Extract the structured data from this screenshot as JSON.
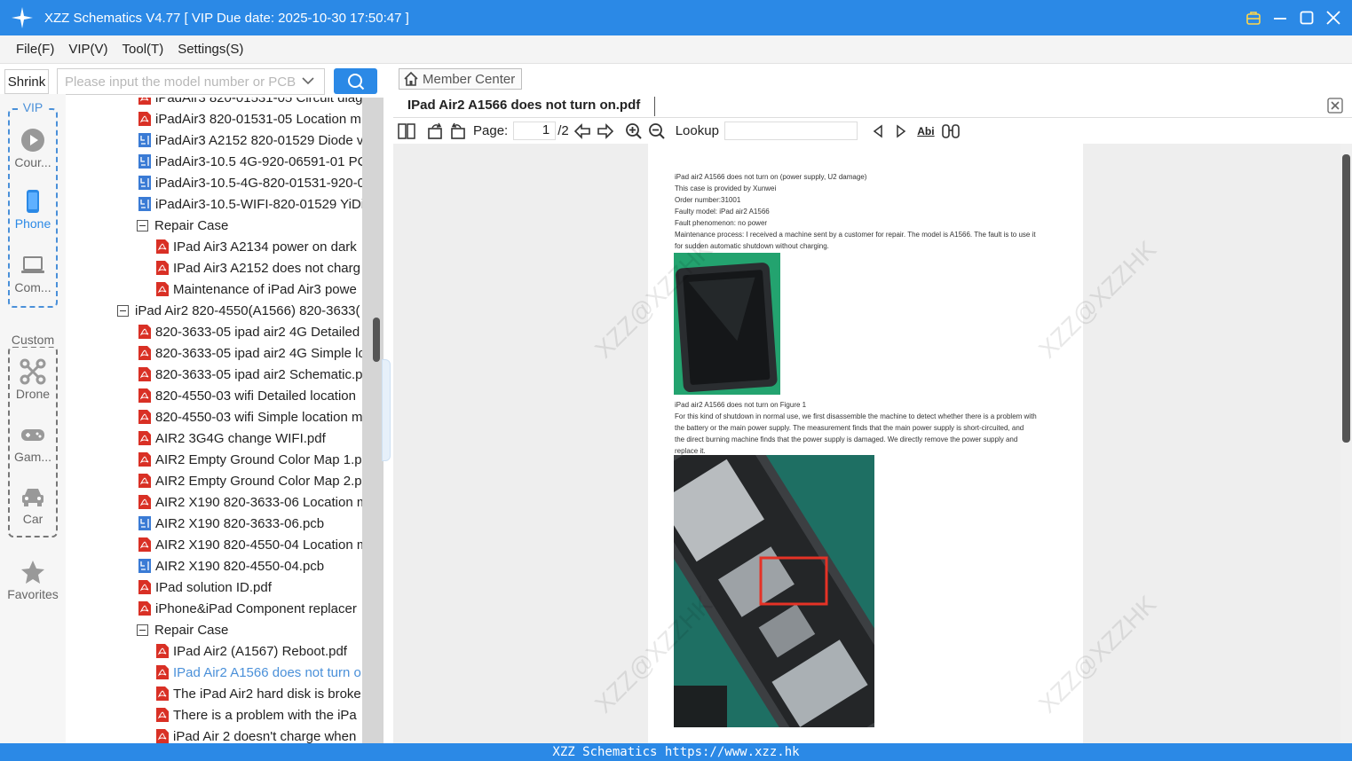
{
  "window": {
    "title": "XZZ Schematics V4.77 [ VIP Due date: 2025-10-30 17:50:47 ]"
  },
  "menu": [
    "File(F)",
    "VIP(V)",
    "Tool(T)",
    "Settings(S)"
  ],
  "toolbar_left": {
    "shrink_label": "Shrink",
    "search_placeholder": "Please input the model number or PCB"
  },
  "rail": {
    "vip_label": "VIP",
    "custom_label": "Custom",
    "items": [
      {
        "label": "Cour...",
        "icon": "play-circle-icon"
      },
      {
        "label": "Phone",
        "icon": "phone-icon"
      },
      {
        "label": "Com...",
        "icon": "laptop-icon"
      },
      {
        "label": "Drone",
        "icon": "drone-icon"
      },
      {
        "label": "Gam...",
        "icon": "gamepad-icon"
      },
      {
        "label": "Car",
        "icon": "car-icon"
      },
      {
        "label": "Favorites",
        "icon": "star-icon"
      }
    ]
  },
  "tree": [
    {
      "label": "iPadAir3 820-01531-05 Circuit diag",
      "type": "pdf"
    },
    {
      "label": "iPadAir3 820-01531-05 Location m",
      "type": "pdf"
    },
    {
      "label": "iPadAir3 A2152 820-01529 Diode v",
      "type": "pcb"
    },
    {
      "label": "iPadAir3-10.5 4G-920-06591-01 PC",
      "type": "pcb"
    },
    {
      "label": "iPadAir3-10.5-4G-820-01531-920-0",
      "type": "pcb"
    },
    {
      "label": "iPadAir3-10.5-WIFI-820-01529 YiDi",
      "type": "pcb"
    },
    {
      "label": "Repair Case",
      "type": "folder"
    },
    {
      "label": "IPad Air3 A2134 power on dark",
      "type": "pdf"
    },
    {
      "label": "IPad Air3 A2152 does not charg",
      "type": "pdf"
    },
    {
      "label": "Maintenance of iPad Air3 powe",
      "type": "pdf"
    },
    {
      "label": "iPad Air2 820-4550(A1566) 820-3633(",
      "type": "folder"
    },
    {
      "label": "820-3633-05 ipad air2 4G Detailed",
      "type": "pdf"
    },
    {
      "label": "820-3633-05 ipad air2 4G Simple lo",
      "type": "pdf"
    },
    {
      "label": "820-3633-05 ipad air2 Schematic.p",
      "type": "pdf"
    },
    {
      "label": "820-4550-03 wifi Detailed location",
      "type": "pdf"
    },
    {
      "label": "820-4550-03 wifi Simple location m",
      "type": "pdf"
    },
    {
      "label": "AIR2 3G4G change WIFI.pdf",
      "type": "pdf"
    },
    {
      "label": "AIR2 Empty Ground Color Map 1.p",
      "type": "pdf"
    },
    {
      "label": "AIR2 Empty Ground Color Map 2.p",
      "type": "pdf"
    },
    {
      "label": "AIR2 X190 820-3633-06 Location m",
      "type": "pdf"
    },
    {
      "label": "AIR2 X190 820-3633-06.pcb",
      "type": "pcb"
    },
    {
      "label": "AIR2 X190 820-4550-04 Location m",
      "type": "pdf"
    },
    {
      "label": "AIR2 X190 820-4550-04.pcb",
      "type": "pcb"
    },
    {
      "label": "IPad solution ID.pdf",
      "type": "pdf"
    },
    {
      "label": "iPhone&iPad Component replacer",
      "type": "pdf"
    },
    {
      "label": "Repair Case",
      "type": "folder"
    },
    {
      "label": "IPad Air2 (A1567) Reboot.pdf",
      "type": "pdf"
    },
    {
      "label": "IPad Air2 A1566 does not turn o",
      "type": "pdf",
      "selected": true
    },
    {
      "label": "The iPad Air2 hard disk is broke",
      "type": "pdf"
    },
    {
      "label": "There is a problem with the iPa",
      "type": "pdf"
    },
    {
      "label": "iPad Air 2 doesn't charge when",
      "type": "pdf"
    }
  ],
  "viewer": {
    "member_center": "Member Center",
    "tab_title": "IPad Air2 A1566 does not turn on.pdf",
    "page_label": "Page:",
    "page_value": "1",
    "page_total": "/2",
    "lookup_label": "Lookup",
    "abi_label": "Abi"
  },
  "doc": {
    "lines_top": [
      "iPad air2 A1566 does not turn on (power supply, U2 damage)",
      "This case is provided by Xunwei",
      "Order number:31001",
      "Faulty model: iPad air2 A1566",
      "Fault phenomenon: no power",
      "Maintenance process: I received a machine sent by a customer for repair. The model is A1566. The fault is to use it",
      "for sudden automatic shutdown without charging."
    ],
    "caption": "iPad air2 A1566 does not turn on Figure 1",
    "lines_mid": [
      "For this kind of shutdown in normal use, we first disassemble the machine to detect whether there is a problem with",
      "the battery or the main power supply. The measurement finds that the main power supply is short-circuited, and",
      "the direct burning machine finds that the power supply is damaged. We directly remove the power supply and",
      "replace it."
    ],
    "watermark": "XZZ@XZZHK"
  },
  "statusbar": "XZZ Schematics https://www.xzz.hk",
  "colors": {
    "accent": "#2b89e6",
    "pdf_red": "#d93025",
    "pcb_blue": "#3a7bd5"
  }
}
